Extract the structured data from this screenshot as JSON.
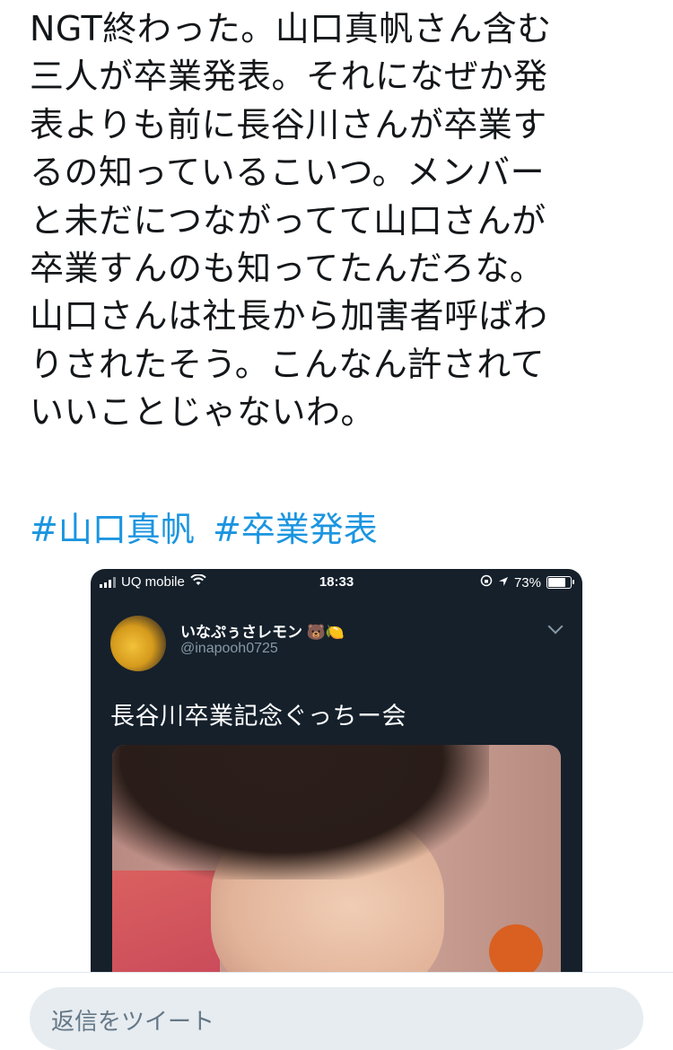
{
  "tweet": {
    "lines": [
      "NGT終わった。山口真帆さん含む",
      "三人が卒業発表。それになぜか発",
      "表よりも前に長谷川さんが卒業す",
      "るの知っているこいつ。メンバー",
      "と未だにつながってて山口さんが",
      "卒業すんのも知ってたんだろな。",
      "山口さんは社長から加害者呼ばわ",
      "りされたそう。こんなん許されて",
      "いいことじゃないわ。"
    ],
    "hashtags": [
      "#山口真帆",
      "#卒業発表"
    ]
  },
  "embedded": {
    "carrier": "UQ mobile",
    "time": "18:33",
    "battery": "73%",
    "display_name": "いなぷぅさレモン",
    "emojis": "🐻🍋",
    "handle": "@inapooh0725",
    "text": "長谷川卒業記念ぐっちー会"
  },
  "reply": {
    "placeholder": "返信をツイート"
  },
  "colors": {
    "text": "#14171a",
    "link": "#1b95e0",
    "embed_bg": "#15202b",
    "reply_bg": "#e6ecf0"
  }
}
